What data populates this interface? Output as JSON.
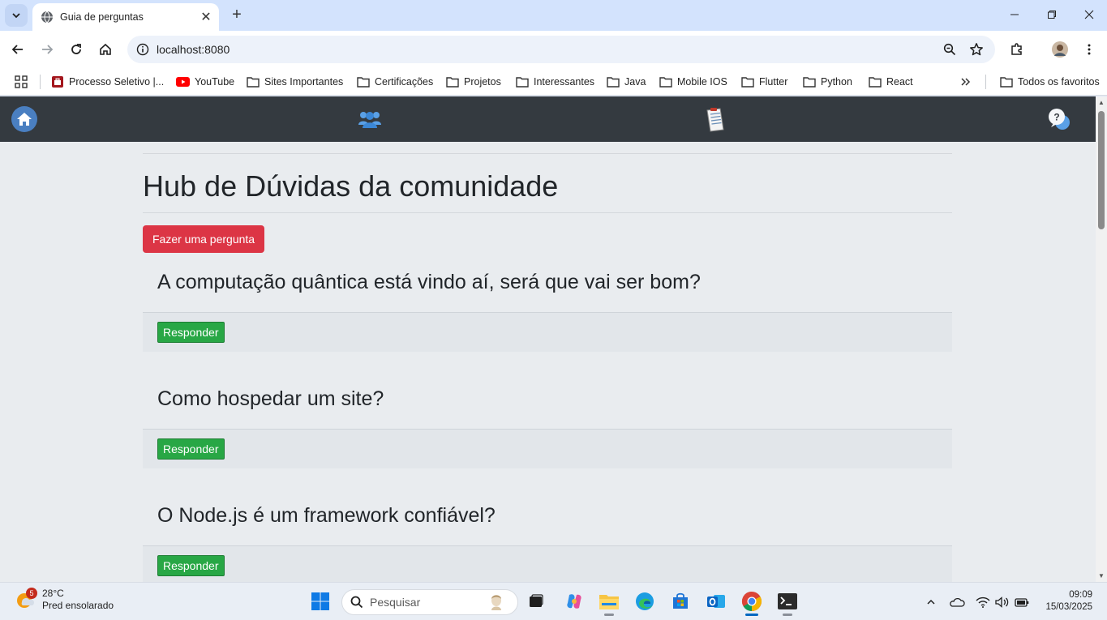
{
  "browser": {
    "tab_title": "Guia de perguntas",
    "url": "localhost:8080",
    "bookmarks": [
      "Processo Seletivo |...",
      "YouTube",
      "Sites Importantes",
      "Certificações",
      "Projetos",
      "Interessantes",
      "Java",
      "Mobile IOS",
      "Flutter",
      "Python",
      "React"
    ],
    "all_bookmarks": "Todos os favoritos"
  },
  "page": {
    "title": "Hub de Dúvidas da comunidade",
    "ask_button": "Fazer uma pergunta",
    "questions": [
      {
        "title": "A computação quântica está vindo aí, será que vai ser bom?",
        "reply_label": "Responder"
      },
      {
        "title": "Como hospedar um site?",
        "reply_label": "Responder"
      },
      {
        "title": "O Node.js é um framework confiável?",
        "reply_label": "Responder"
      }
    ]
  },
  "taskbar": {
    "weather_temp": "28°C",
    "weather_desc": "Pred ensolarado",
    "weather_badge": "5",
    "search_placeholder": "Pesquisar",
    "time": "09:09",
    "date": "15/03/2025"
  },
  "colors": {
    "navbar": "#343a40",
    "ask_button": "#dc3545",
    "reply_button": "#28a745",
    "page_bg": "#e9ecef"
  }
}
